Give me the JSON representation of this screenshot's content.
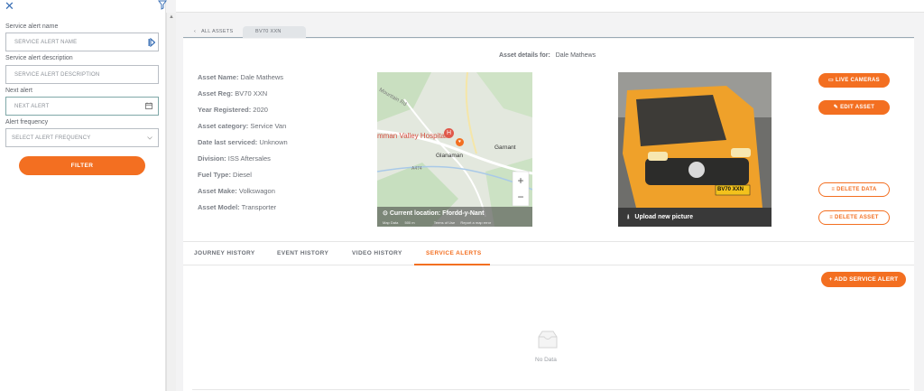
{
  "sidebar": {
    "close_icon": "close-icon",
    "filter_icon": "funnel-icon",
    "fields": [
      {
        "label": "Service alert name",
        "placeholder": "SERVICE ALERT NAME",
        "icon": "arrow-tab-icon"
      },
      {
        "label": "Service alert description",
        "placeholder": "SERVICE ALERT DESCRIPTION"
      },
      {
        "label": "Next alert",
        "placeholder": "NEXT ALERT",
        "icon": "calendar-icon"
      },
      {
        "label": "Alert frequency",
        "placeholder": "SELECT ALERT FREQUENCY",
        "icon": "chevron-down-icon"
      }
    ],
    "filter_label": "FILTER"
  },
  "breadcrumb": {
    "back_label": "ALL ASSETS",
    "current_label": "BV70 XXN"
  },
  "details": {
    "heading_label": "Asset details for:",
    "heading_value": "Dale Mathews",
    "attributes": [
      {
        "label": "Asset Name:",
        "value": "Dale Mathews"
      },
      {
        "label": "Asset Reg:",
        "value": "BV70 XXN"
      },
      {
        "label": "Year Registered:",
        "value": "2020"
      },
      {
        "label": "Asset category:",
        "value": "Service Van"
      },
      {
        "label": "Date last serviced:",
        "value": "Unknown"
      },
      {
        "label": "Division:",
        "value": "ISS Aftersales"
      },
      {
        "label": "Fuel Type:",
        "value": "Diesel"
      },
      {
        "label": "Asset Make:",
        "value": "Volkswagon"
      },
      {
        "label": "Asset Model:",
        "value": "Transporter"
      }
    ]
  },
  "map": {
    "hospital_label": "mman Valley Hospital",
    "town1": "Glanaman",
    "town2": "Garnant",
    "road": "A474",
    "road2": "Mountain Rd",
    "current_location": "Current location: Ffordd-y-Nant",
    "map_data": "Map Data",
    "scale": "500 m",
    "terms": "Terms of Use",
    "report": "Report a map error",
    "zoom_in": "+",
    "zoom_out": "−"
  },
  "photo": {
    "plate": "BV70 XXN",
    "upload_label": "Upload new picture"
  },
  "actions": {
    "live_cameras": "LIVE CAMERAS",
    "edit_asset": "EDIT ASSET",
    "delete_data": "DELETE DATA",
    "delete_asset": "DELETE ASSET"
  },
  "tabs": [
    {
      "label": "JOURNEY HISTORY"
    },
    {
      "label": "EVENT HISTORY"
    },
    {
      "label": "VIDEO HISTORY"
    },
    {
      "label": "SERVICE ALERTS",
      "active": true
    }
  ],
  "service_alerts": {
    "add_label": "+ ADD SERVICE ALERT",
    "empty_label": "No Data"
  },
  "colors": {
    "accent": "#f36f21",
    "text": "#6b6f76"
  }
}
